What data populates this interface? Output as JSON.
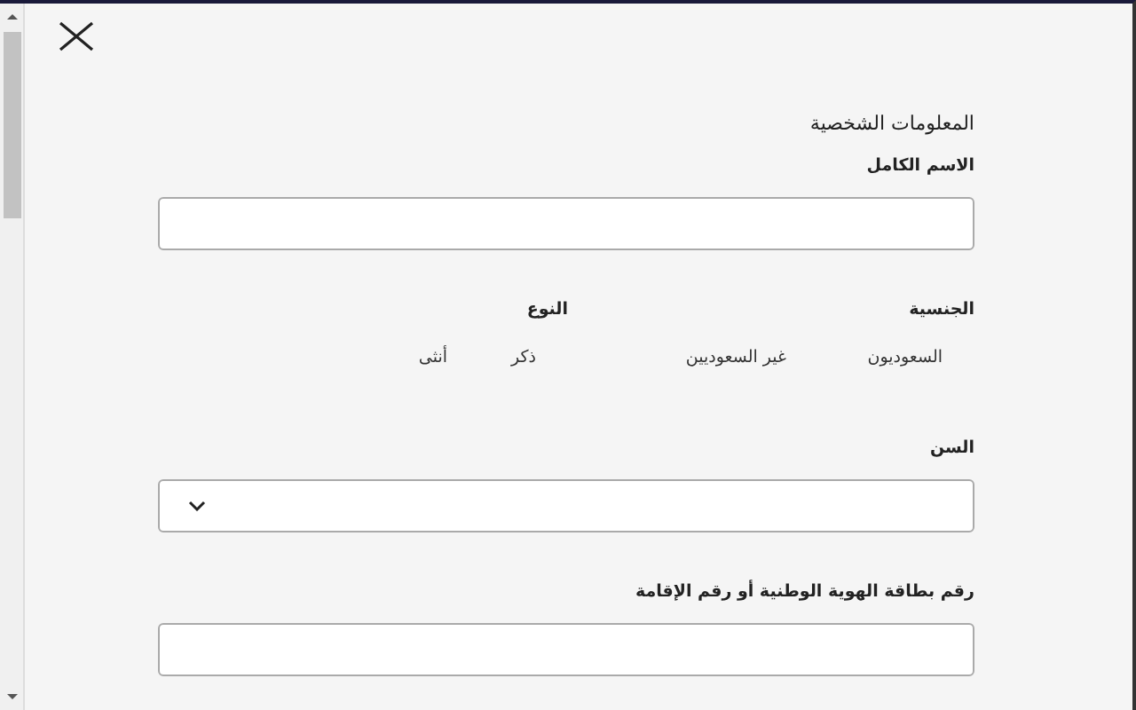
{
  "section_title": "المعلومات الشخصية",
  "full_name": {
    "label": "الاسم الكامل"
  },
  "nationality": {
    "label": "الجنسية",
    "options": [
      {
        "label": "السعوديون"
      },
      {
        "label": "غير السعوديين"
      }
    ]
  },
  "gender": {
    "label": "النوع",
    "options": [
      {
        "label": "ذكر"
      },
      {
        "label": "أنثى"
      }
    ]
  },
  "age": {
    "label": "السن"
  },
  "id_number": {
    "label": "رقم بطاقة الهوية الوطنية أو رقم الإقامة"
  }
}
